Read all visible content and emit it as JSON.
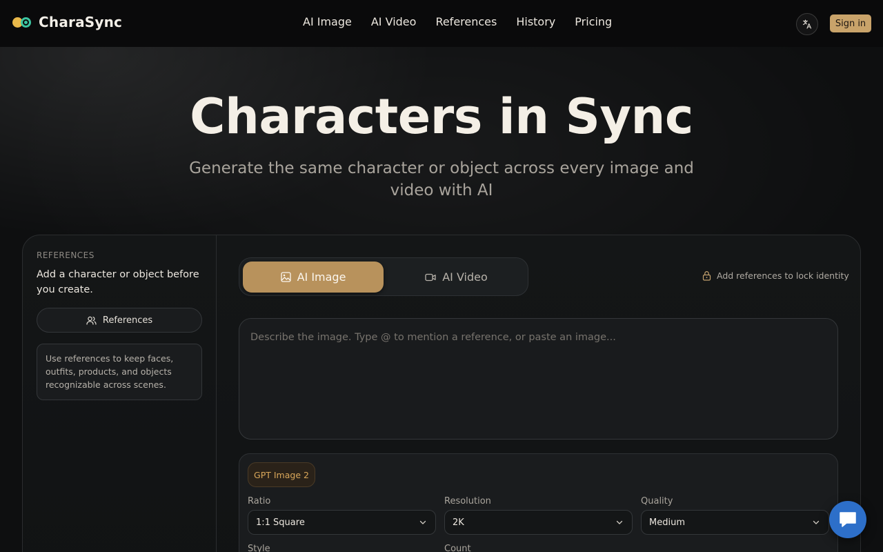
{
  "header": {
    "brand": "CharaSync",
    "nav": [
      "AI Image",
      "AI Video",
      "References",
      "History",
      "Pricing"
    ],
    "signin_label": "Sign in"
  },
  "hero": {
    "title": "Characters in Sync",
    "subtitle": "Generate the same character or object across every image and video with AI"
  },
  "sidebar": {
    "label": "REFERENCES",
    "title": "Add a character or object before you create.",
    "button_label": "References",
    "note": "Use references to keep faces, outfits, products, and objects recognizable across scenes."
  },
  "mode_tabs": {
    "image_label": "AI Image",
    "video_label": "AI Video",
    "active": "AI Image"
  },
  "lock_hint": "Add references to lock identity",
  "prompt": {
    "placeholder": "Describe the image. Type @ to mention a reference, or paste an image...",
    "value": ""
  },
  "settings": {
    "model": "GPT Image 2",
    "ratio_label": "Ratio",
    "ratio_value": "1:1 Square",
    "resolution_label": "Resolution",
    "resolution_value": "2K",
    "quality_label": "Quality",
    "quality_value": "Medium",
    "style_label": "Style",
    "count_label": "Count"
  },
  "colors": {
    "accent": "#b8925c",
    "accent_text": "#d9a75a",
    "signin_bg": "#c9a36a",
    "chat_fab": "#2d6fc9",
    "background": "#0e0f10"
  }
}
